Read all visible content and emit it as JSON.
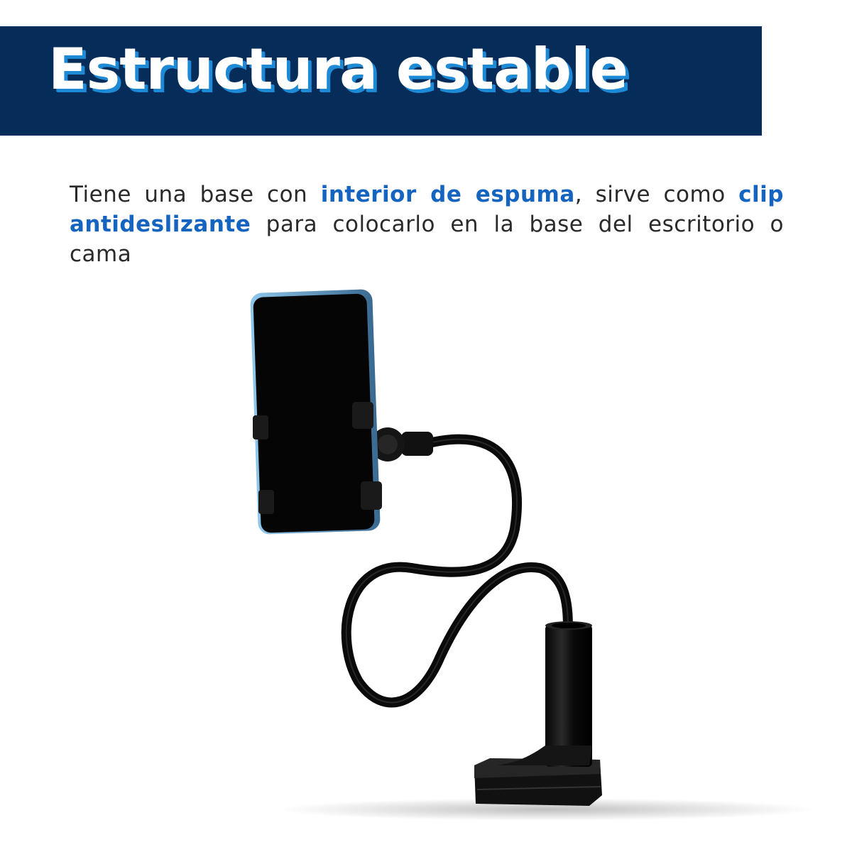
{
  "header": {
    "title": "Estructura estable",
    "banner_color": "#062c5a",
    "title_shadow_color": "#1e8ad6"
  },
  "description": {
    "part1": "Tiene una base con ",
    "highlight1": "interior de espuma",
    "part2": ", sirve como ",
    "highlight2": "clip antideslizante",
    "part3": " para colocarlo en la base del escritorio o cama",
    "highlight_color": "#1565c0"
  },
  "product": {
    "image": "flexible-gooseneck-phone-holder-with-clamp"
  }
}
